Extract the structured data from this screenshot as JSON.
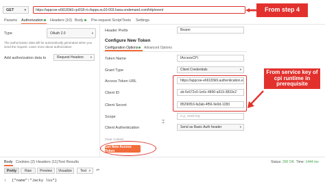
{
  "request": {
    "method": "GET",
    "url": "https://appcoe-e66183k9.cpi018-rt.cfapps.eu10-003.hana.ondemand.com/http/event"
  },
  "callouts": {
    "step4": "From step 4",
    "service_key": "From service key of cpi runtime in prerequisite"
  },
  "tabs": [
    {
      "label": "Params"
    },
    {
      "label": "Authorization"
    },
    {
      "label": "Headers (10)"
    },
    {
      "label": "Body"
    },
    {
      "label": "Pre-request Script"
    },
    {
      "label": "Tests"
    },
    {
      "label": "Settings"
    }
  ],
  "auth": {
    "type_label": "Type",
    "type_value": "OAuth 2.0",
    "description": "The authorization data will be automatically generated when you send the request. Learn more about authorization",
    "add_to_label": "Add authorization data to",
    "add_to_value": "Request Headers"
  },
  "config": {
    "header_prefix_label": "Header Prefix",
    "header_prefix_value": "Bearer",
    "section_title": "Configure New Token",
    "subtabs": [
      "Configuration Options",
      "Advanced Options"
    ],
    "token_name_label": "Token Name",
    "token_name_value": "IAccessCPI",
    "grant_type_label": "Grant Type",
    "grant_type_value": "Client Credentials",
    "access_token_url_label": "Access Token URL",
    "access_token_url_value": "https://appcoe-e66183k9.authentication.eu",
    "client_id_label": "Client ID",
    "client_id_value": "sb-6c672c0-1e6c-4890-a519-3833c2",
    "client_secret_label": "Client Secret",
    "client_secret_value": "85290f16-fa3ab-4f56-9e0d-1283",
    "scope_label": "Scope",
    "scope_placeholder": "e.g. read:org",
    "client_auth_label": "Client Authentication",
    "client_auth_value": "Send as Basic Auth header",
    "clear_cookies_label": "Clear cookies",
    "get_token_button": "Get New Access Token"
  },
  "response": {
    "tabs": [
      "Body",
      "Cookies (2)",
      "Headers (11)",
      "Test Results"
    ],
    "status_label": "Status:",
    "status_value": "200 OK",
    "time_label": "Time:",
    "time_value": "1444 ms",
    "views": [
      "Pretty",
      "Raw",
      "Preview",
      "Visualize"
    ],
    "format": "Text",
    "line_number": "1",
    "body_text": "{\"name\":\"Jacky liu\"}"
  },
  "colors": {
    "accent": "#f26b3a",
    "callout": "#e2312d",
    "status_ok": "#3fa24a"
  }
}
